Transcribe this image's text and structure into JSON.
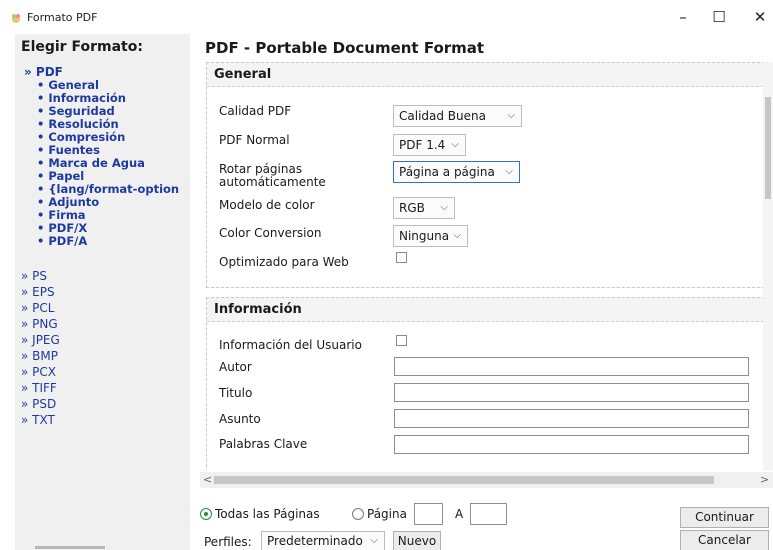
{
  "window": {
    "title": "Formato PDF",
    "minimize": "–",
    "maximize": "☐",
    "close": "✕"
  },
  "sidebar": {
    "heading": "Elegir Formato:",
    "pdf_label": "» PDF",
    "pdf_items": [
      "• General",
      "• Información",
      "• Seguridad",
      "• Resolución",
      "• Compresión",
      "• Fuentes",
      "• Marca de Agua",
      "• Papel",
      "• {lang/format-option",
      "• Adjunto",
      "• Firma",
      "• PDF/X",
      "• PDF/A"
    ],
    "formats": [
      "» PS",
      "» EPS",
      "» PCL",
      "» PNG",
      "» JPEG",
      "» BMP",
      "» PCX",
      "» TIFF",
      "» PSD",
      "» TXT"
    ]
  },
  "main": {
    "title": "PDF - Portable Document Format"
  },
  "general": {
    "heading": "General",
    "calidad_label": "Calidad PDF",
    "calidad_value": "Calidad Buena",
    "normal_label": "PDF Normal",
    "normal_value": "PDF 1.4",
    "rotar_label_1": "Rotar páginas",
    "rotar_label_2": "automáticamente",
    "rotar_value": "Página a página",
    "modelo_label": "Modelo de color",
    "modelo_value": "RGB",
    "conversion_label": "Color Conversion",
    "conversion_value": "Ninguna",
    "web_label": "Optimizado para Web"
  },
  "info": {
    "heading": "Información",
    "usuario_label": "Información del Usuario",
    "autor_label": "Autor",
    "titulo_label": "Titulo",
    "asunto_label": "Asunto",
    "claves_label": "Palabras Clave"
  },
  "pages": {
    "todas_label": "Todas las Páginas",
    "pagina_label": "Página",
    "a_label": "A"
  },
  "profiles": {
    "label": "Perfiles:",
    "value": "Predeterminado",
    "nuevo": "Nuevo"
  },
  "buttons": {
    "continuar": "Continuar",
    "cancelar": "Cancelar"
  },
  "icons": {
    "chevron": "⌵",
    "left": "<",
    "right": ">"
  }
}
